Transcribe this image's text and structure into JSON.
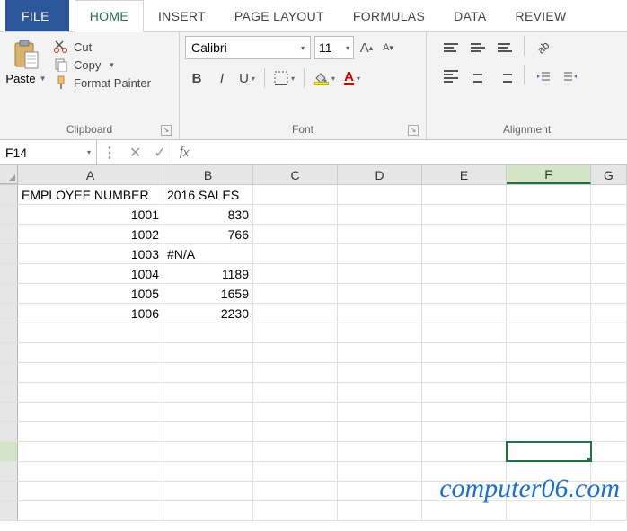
{
  "tabs": {
    "file": "FILE",
    "home": "HOME",
    "insert": "INSERT",
    "page_layout": "PAGE LAYOUT",
    "formulas": "FORMULAS",
    "data": "DATA",
    "review": "REVIEW"
  },
  "clipboard": {
    "paste": "Paste",
    "cut": "Cut",
    "copy": "Copy",
    "painter": "Format Painter",
    "group_label": "Clipboard"
  },
  "font": {
    "name": "Calibri",
    "size": "11",
    "group_label": "Font"
  },
  "alignment": {
    "group_label": "Alignment"
  },
  "namebox": "F14",
  "formula": "",
  "columns": [
    "A",
    "B",
    "C",
    "D",
    "E",
    "F",
    "G"
  ],
  "data_rows": [
    {
      "a": "EMPLOYEE NUMBER",
      "a_align": "l",
      "b": "2016 SALES",
      "b_align": "l"
    },
    {
      "a": "1001",
      "a_align": "r",
      "b": "830",
      "b_align": "r"
    },
    {
      "a": "1002",
      "a_align": "r",
      "b": "766",
      "b_align": "r"
    },
    {
      "a": "1003",
      "a_align": "r",
      "b": "#N/A",
      "b_align": "l"
    },
    {
      "a": "1004",
      "a_align": "r",
      "b": "1189",
      "b_align": "r"
    },
    {
      "a": "1005",
      "a_align": "r",
      "b": "1659",
      "b_align": "r"
    },
    {
      "a": "1006",
      "a_align": "r",
      "b": "2230",
      "b_align": "r"
    }
  ],
  "selected_cell": {
    "col": "F",
    "row": 14
  },
  "watermark": "computer06.com",
  "chart_data": {
    "type": "table",
    "columns": [
      "EMPLOYEE NUMBER",
      "2016 SALES"
    ],
    "rows": [
      [
        1001,
        830
      ],
      [
        1002,
        766
      ],
      [
        1003,
        "#N/A"
      ],
      [
        1004,
        1189
      ],
      [
        1005,
        1659
      ],
      [
        1006,
        2230
      ]
    ]
  }
}
